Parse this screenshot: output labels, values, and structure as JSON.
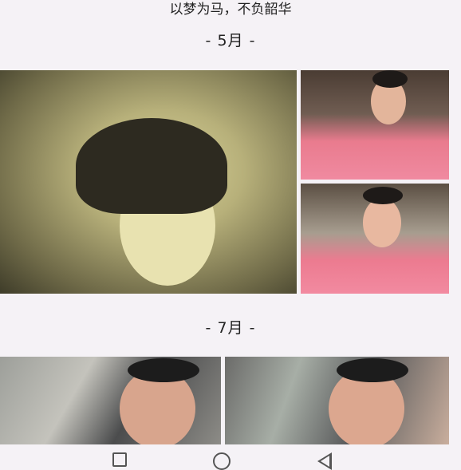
{
  "caption": "以梦为马，不负韶华",
  "sections": [
    {
      "month": "- 5月 -"
    },
    {
      "month": "- 7月 -"
    }
  ],
  "nav_icons": [
    "recent-apps-icon",
    "home-icon",
    "back-icon"
  ]
}
